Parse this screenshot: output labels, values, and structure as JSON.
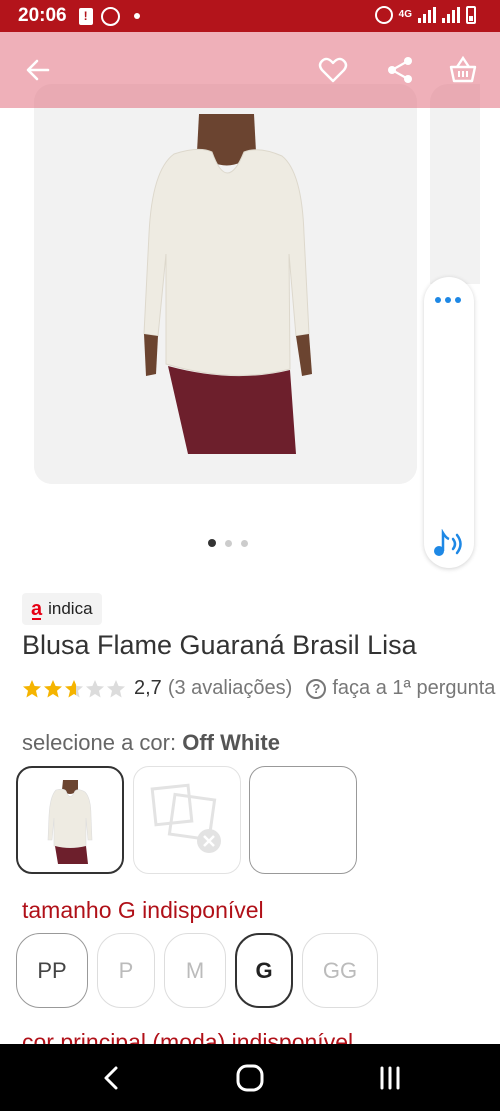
{
  "status_bar": {
    "time": "20:06",
    "network": "4G"
  },
  "app_bar": {
    "icons": [
      "back-arrow-icon",
      "heart-icon",
      "share-icon",
      "basket-icon"
    ]
  },
  "gallery": {
    "image_count": 3,
    "active_index": 0
  },
  "badge": {
    "logo": "a",
    "text": "indica"
  },
  "product": {
    "title": "Blusa Flame Guaraná Brasil Lisa",
    "rating_value": "2,7",
    "rating_stars": 2.7,
    "rating_count": "(3 avaliações)",
    "ask_text": "faça a 1ª pergunta"
  },
  "color": {
    "label": "selecione a cor: ",
    "selected": "Off White"
  },
  "size": {
    "label": "tamanho G indisponível",
    "options": [
      "PP",
      "P",
      "M",
      "G",
      "GG"
    ]
  },
  "next_section_text": "cor principal (moda) indisponível",
  "colors": {
    "brand_red": "#b3141b",
    "accent_blue": "#1e88e5",
    "star_gold": "#f5b400"
  }
}
